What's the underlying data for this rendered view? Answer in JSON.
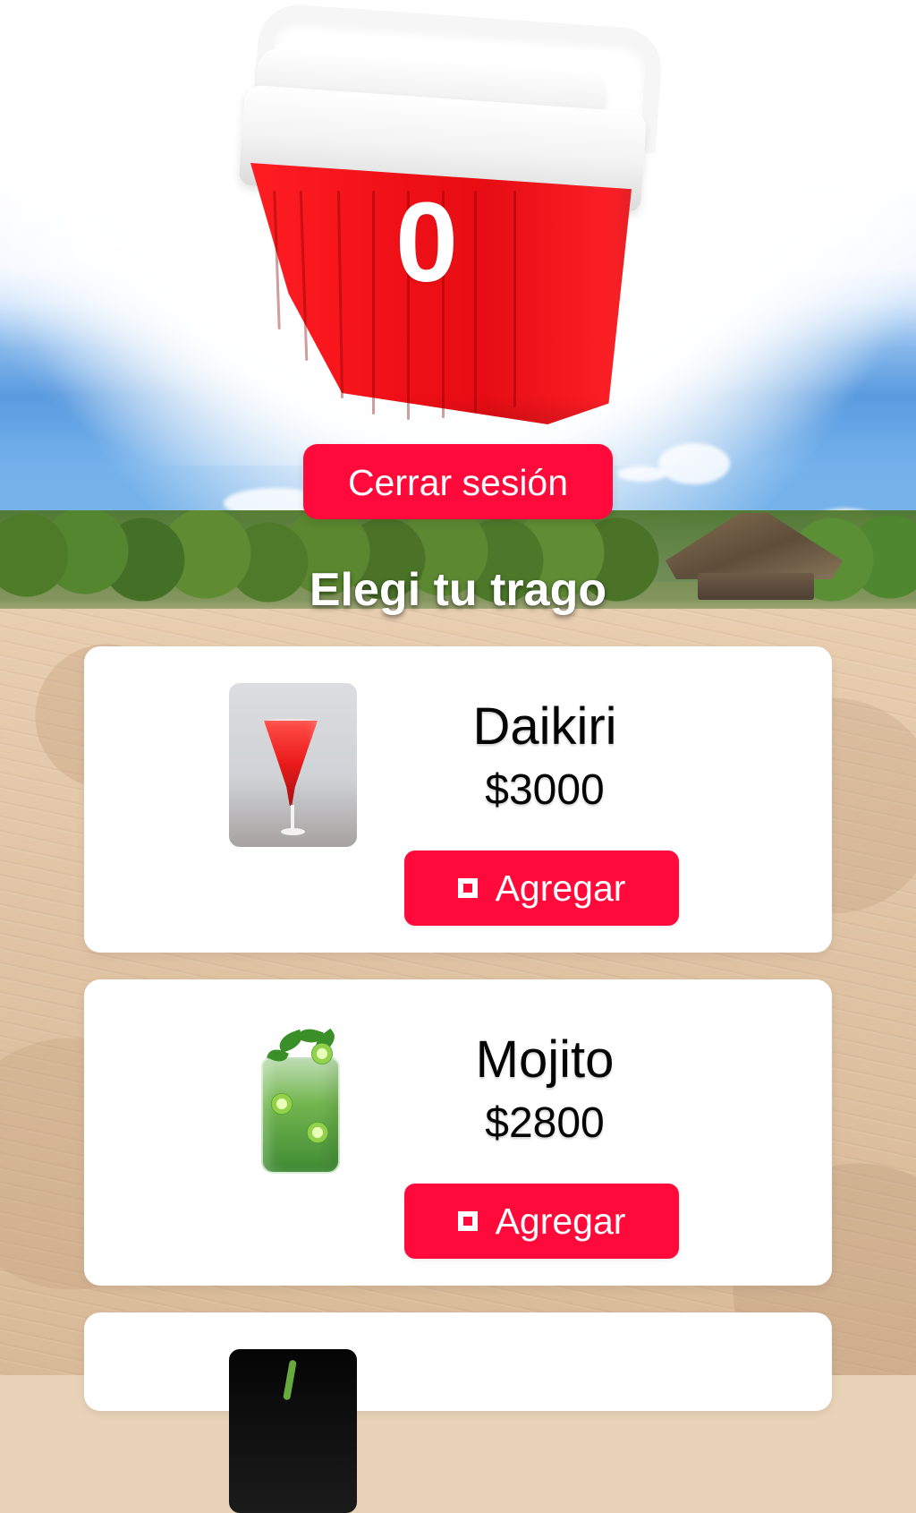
{
  "cooler": {
    "count": "0"
  },
  "actions": {
    "logout_label": "Cerrar sesión"
  },
  "page": {
    "title": "Elegi tu trago"
  },
  "products": [
    {
      "name": "Daikiri",
      "price": "$3000",
      "button_label": "Agregar"
    },
    {
      "name": "Mojito",
      "price": "$2800",
      "button_label": "Agregar"
    }
  ],
  "colors": {
    "accent": "#ff0a3b",
    "card_background": "#ffffff",
    "text_dark": "#050505"
  },
  "icons": {
    "cooler": "cooler-icon",
    "add": "square-add-icon"
  }
}
